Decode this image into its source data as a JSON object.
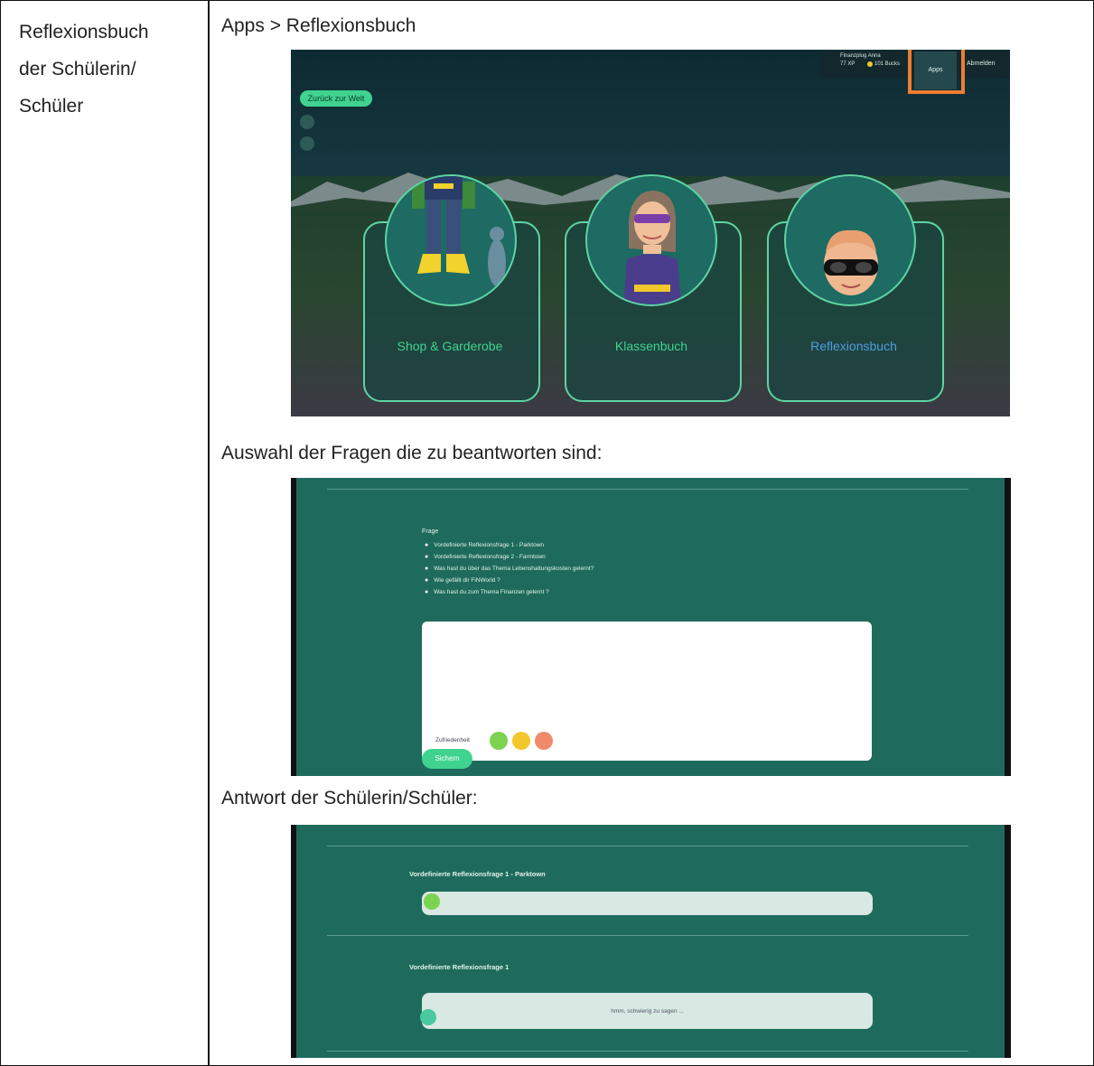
{
  "left_cell": {
    "line1": "Reflexionsbuch",
    "line2": "der Schülerin/",
    "line3": "Schüler"
  },
  "right_cell": {
    "breadcrumb": "Apps > Reflexionsbuch",
    "section_select": "Auswahl der Fragen die zu beantworten sind:",
    "section_answer": "Antwort der Schülerin/Schüler:"
  },
  "screenshot_apps": {
    "back_button": "Zurück zur Welt",
    "hud_title": "Finanzplug Anna",
    "hud_xp": "77 XP",
    "hud_coins": "101 Bucks",
    "apps_button": "Apps",
    "hud_right": "Abmelden",
    "highlight_color": "#ed7d31",
    "cards": [
      {
        "label": "Shop & Garderobe",
        "label_color": "#3fd38f"
      },
      {
        "label": "Klassenbuch",
        "label_color": "#3fd38f"
      },
      {
        "label": "Reflexionsbuch",
        "label_color": "#4f9be0"
      }
    ]
  },
  "screenshot_questions": {
    "frage_label": "Frage",
    "questions": [
      "Vordefinierte Reflexionsfrage 1 - Parktown",
      "Vordefinierte Reflexionsfrage 2 - Farmtown",
      "Was hast du über das Thema Lebenshaltungskosten gelernt?",
      "Wie gefällt dir FiNWorld ?",
      "Was hast du zum Thema Finanzen gelernt ?"
    ],
    "satisfaction_label": "Zufriedenheit",
    "save_button": "Sichern",
    "smiley_colors": [
      "#7cd34f",
      "#f2c72c",
      "#f08a6a"
    ]
  },
  "screenshot_answers": {
    "answers": [
      {
        "question": "Vordefinierte Reflexionsfrage 1 - Parktown",
        "answer": "",
        "smiley_color": "#7cd34f"
      },
      {
        "question": "Vordefinierte Reflexionsfrage 1",
        "answer": "hmm, schwierig zu sagen ...",
        "smiley_color": "#48c9a0"
      }
    ]
  }
}
